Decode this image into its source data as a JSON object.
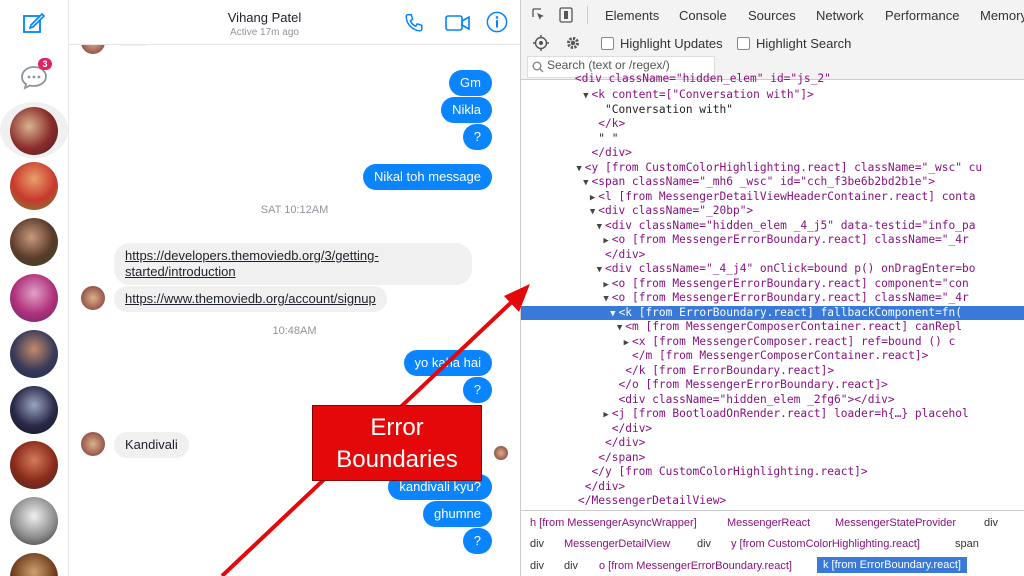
{
  "messenger": {
    "contact_name": "Vihang Patel",
    "contact_status": "Active 17m ago",
    "unread_badge": "3",
    "messages": {
      "m1": "Gm",
      "m2": "Nikla",
      "m3": "?",
      "m4": "Nikal toh message",
      "ts1": "SAT 10:12AM",
      "link1_line1": "https://developers.themoviedb.org/3/getting-",
      "link1_line2": "started/introduction",
      "link2": "https://www.themoviedb.org/account/signup",
      "ts2": "10:48AM",
      "m5": "yo kaha hai",
      "m6": "?",
      "m7": "Kandivali",
      "m8": "kandivali kyu?",
      "m9": "ghumne",
      "m10": "?"
    },
    "icons": [
      "compose-icon",
      "chat-bubble-icon",
      "phone-icon",
      "video-icon",
      "info-icon"
    ]
  },
  "devtools": {
    "tabs": [
      "Elements",
      "Console",
      "Sources",
      "Network",
      "Performance",
      "Memory"
    ],
    "checkbox_highlight_updates": "Highlight Updates",
    "checkbox_highlight_search": "Highlight Search",
    "search_placeholder": "Search (text or /regex/)",
    "tree": [
      {
        "indent": 10,
        "arrow": "▼",
        "text": "<k content=[\"Conversation with\"]>"
      },
      {
        "indent": 12,
        "arrow": "",
        "text": "\"Conversation with\""
      },
      {
        "indent": 11,
        "arrow": "",
        "text": "</k>"
      },
      {
        "indent": 11,
        "arrow": "",
        "text": "\" \""
      },
      {
        "indent": 10,
        "arrow": "",
        "text": "</div>"
      },
      {
        "indent": 9,
        "arrow": "▼",
        "text": "<y [from CustomColorHighlighting.react] className=\"_wsc\" cu"
      },
      {
        "indent": 10,
        "arrow": "▼",
        "text": "<span className=\"_mh6 _wsc\" id=\"cch_f3be6b2bd2b1e\">"
      },
      {
        "indent": 11,
        "arrow": "▶",
        "text": "<l [from MessengerDetailViewHeaderContainer.react] conta"
      },
      {
        "indent": 11,
        "arrow": "▼",
        "text": "<div className=\"_20bp\">"
      },
      {
        "indent": 12,
        "arrow": "▼",
        "text": "<div className=\"hidden_elem _4_j5\" data-testid=\"info_pa"
      },
      {
        "indent": 13,
        "arrow": "▶",
        "text": "<o [from MessengerErrorBoundary.react] className=\"_4r"
      },
      {
        "indent": 12,
        "arrow": "",
        "text": "</div>"
      },
      {
        "indent": 12,
        "arrow": "▼",
        "text": "<div className=\"_4_j4\" onClick=bound p() onDragEnter=bo"
      },
      {
        "indent": 13,
        "arrow": "▶",
        "text": "<o [from MessengerErrorBoundary.react] component=\"con"
      },
      {
        "indent": 13,
        "arrow": "▼",
        "text": "<o [from MessengerErrorBoundary.react] className=\"_4r"
      },
      {
        "indent": 14,
        "arrow": "▼",
        "text": "<k [from ErrorBoundary.react] fallbackComponent=fn(",
        "selected": true
      },
      {
        "indent": 15,
        "arrow": "▼",
        "text": "<m [from MessengerComposerContainer.react] canRepl"
      },
      {
        "indent": 16,
        "arrow": "▶",
        "text": "<x [from MessengerComposer.react] ref=bound () c"
      },
      {
        "indent": 16,
        "arrow": "",
        "text": "</m [from MessengerComposerContainer.react]>"
      },
      {
        "indent": 15,
        "arrow": "",
        "text": "</k [from ErrorBoundary.react]>"
      },
      {
        "indent": 14,
        "arrow": "",
        "text": "</o [from MessengerErrorBoundary.react]>"
      },
      {
        "indent": 14,
        "arrow": "",
        "text": "<div className=\"hidden_elem _2fg6\"></div>"
      },
      {
        "indent": 13,
        "arrow": "▶",
        "text": "<j [from BootloadOnRender.react] loader=h{…} placehol"
      },
      {
        "indent": 13,
        "arrow": "",
        "text": "</div>"
      },
      {
        "indent": 12,
        "arrow": "",
        "text": "</div>"
      },
      {
        "indent": 11,
        "arrow": "",
        "text": "</span>"
      },
      {
        "indent": 10,
        "arrow": "",
        "text": "</y [from CustomColorHighlighting.react]>"
      },
      {
        "indent": 9,
        "arrow": "",
        "text": "</div>"
      },
      {
        "indent": 8,
        "arrow": "",
        "text": "</MessengerDetailView>"
      }
    ],
    "breadcrumbs_row1": [
      "h [from MessengerAsyncWrapper]",
      "MessengerReact",
      "MessengerStateProvider",
      "div"
    ],
    "breadcrumbs_row2": [
      "div",
      "MessengerDetailView",
      "div",
      "y [from CustomColorHighlighting.react]",
      "span"
    ],
    "breadcrumbs_row3": [
      "div",
      "div",
      "o [from MessengerErrorBoundary.react]",
      "k [from ErrorBoundary.react]"
    ]
  },
  "overlay": {
    "callout_line1": "Error",
    "callout_line2": "Boundaries",
    "callout_color": "#e4080a",
    "arrow_color": "#e4080a"
  }
}
